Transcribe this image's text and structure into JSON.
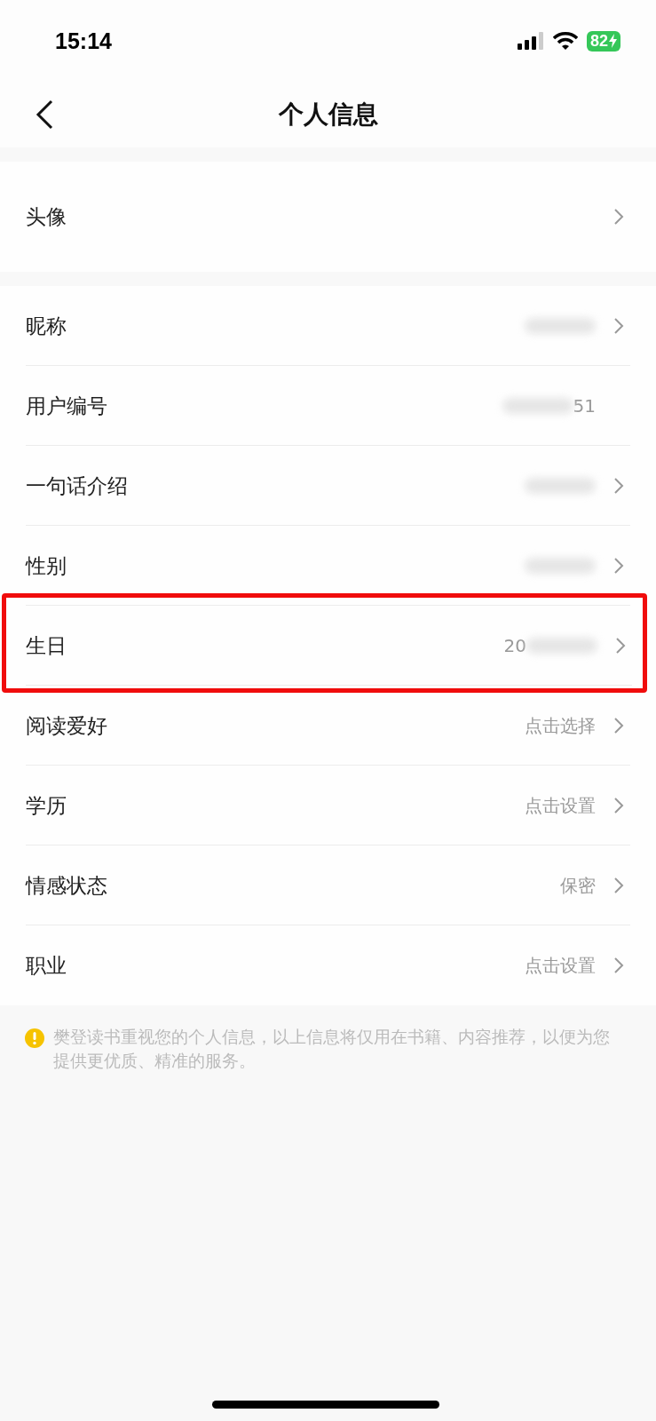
{
  "status_bar": {
    "time": "15:14",
    "battery": "82"
  },
  "nav": {
    "title": "个人信息"
  },
  "groups": [
    {
      "rows": [
        {
          "label": "头像",
          "value": [],
          "arrow": true,
          "highlighted": false
        }
      ]
    },
    {
      "rows": [
        {
          "label": "昵称",
          "value": [
            {
              "kind": "blur"
            }
          ],
          "arrow": true,
          "highlighted": false
        },
        {
          "label": "用户编号",
          "value": [
            {
              "kind": "blur"
            },
            {
              "kind": "text",
              "text": "51"
            }
          ],
          "arrow": false,
          "highlighted": false
        },
        {
          "label": "一句话介绍",
          "value": [
            {
              "kind": "blur"
            }
          ],
          "arrow": true,
          "highlighted": false
        },
        {
          "label": "性别",
          "value": [
            {
              "kind": "blur"
            }
          ],
          "arrow": true,
          "highlighted": false
        },
        {
          "label": "生日",
          "value": [
            {
              "kind": "text",
              "text": "20"
            },
            {
              "kind": "blur"
            }
          ],
          "arrow": true,
          "highlighted": true
        },
        {
          "label": "阅读爱好",
          "value": [
            {
              "kind": "text",
              "text": "点击选择"
            }
          ],
          "arrow": true,
          "highlighted": false
        },
        {
          "label": "学历",
          "value": [
            {
              "kind": "text",
              "text": "点击设置"
            }
          ],
          "arrow": true,
          "highlighted": false
        },
        {
          "label": "情感状态",
          "value": [
            {
              "kind": "text",
              "text": "保密"
            }
          ],
          "arrow": true,
          "highlighted": false
        },
        {
          "label": "职业",
          "value": [
            {
              "kind": "text",
              "text": "点击设置"
            }
          ],
          "arrow": true,
          "highlighted": false
        }
      ]
    }
  ],
  "notice": {
    "text": "樊登读书重视您的个人信息，以上信息将仅用在书籍、内容推荐，以便为您提供更优质、精准的服务。"
  }
}
